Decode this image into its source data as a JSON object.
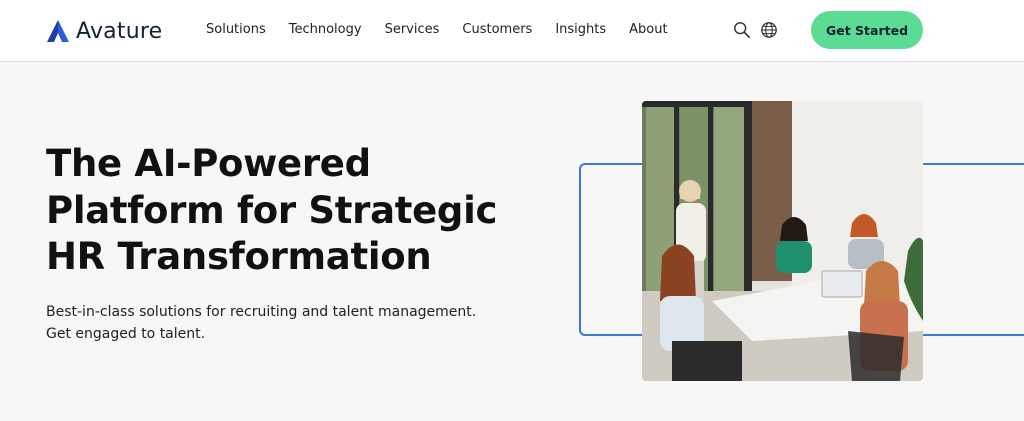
{
  "brand": {
    "name": "Avature",
    "logo_color": "#2e5bd6"
  },
  "nav": {
    "items": [
      {
        "label": "Solutions"
      },
      {
        "label": "Technology"
      },
      {
        "label": "Services"
      },
      {
        "label": "Customers"
      },
      {
        "label": "Insights"
      },
      {
        "label": "About"
      }
    ]
  },
  "header_icons": {
    "search": "search-icon",
    "language": "globe-icon"
  },
  "cta": {
    "label": "Get Started",
    "color": "#5cdb95"
  },
  "hero": {
    "title_lines": [
      "The AI-Powered",
      "Platform for Strategic",
      "HR Transformation"
    ],
    "subtitle_lines": [
      "Best-in-class solutions for recruiting and talent management.",
      "Get engaged to talent."
    ]
  },
  "accent_color": "#3a7bd5"
}
